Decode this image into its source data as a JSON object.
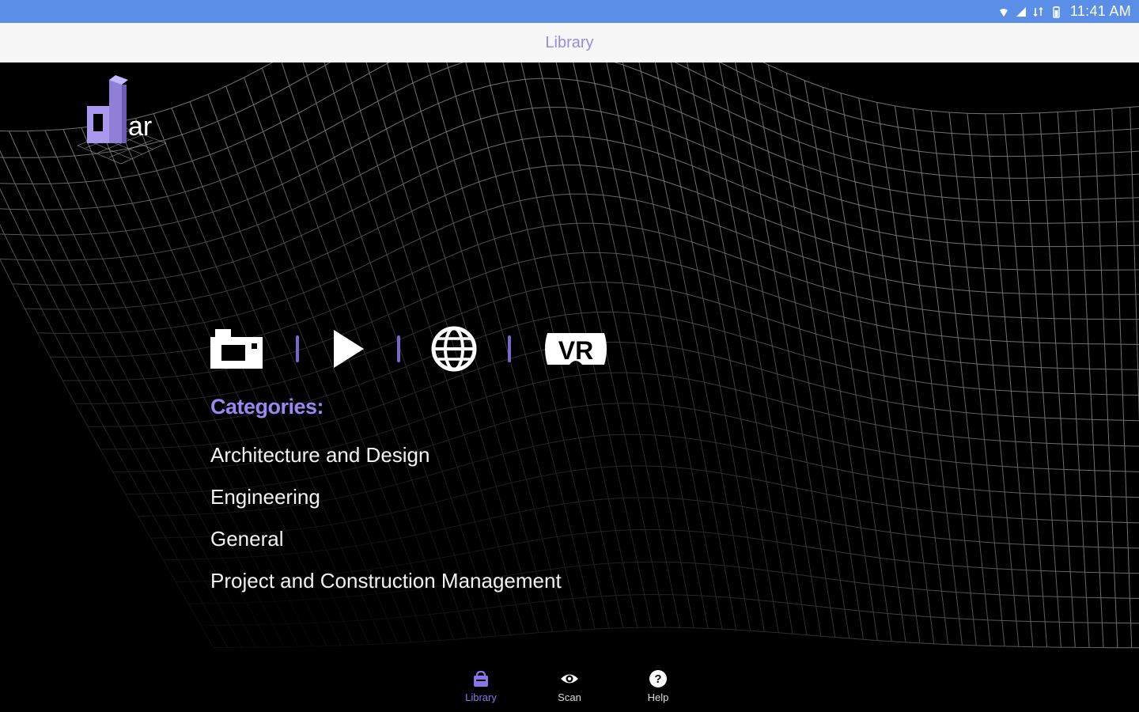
{
  "status_bar": {
    "time": "11:41 AM",
    "icons": [
      "wifi-icon",
      "signal-icon",
      "data-icon",
      "battery-icon"
    ]
  },
  "app_bar": {
    "title": "Library"
  },
  "logo": {
    "text": "dar",
    "icon": "dar-logo"
  },
  "media_icons": [
    "camera-icon",
    "play-icon",
    "globe-icon",
    "vr-icon"
  ],
  "vr_label": "VR",
  "categories": {
    "heading": "Categories:",
    "items": [
      "Architecture and Design",
      "Engineering",
      "General",
      "Project and Construction Management"
    ]
  },
  "bottom_nav": [
    {
      "label": "Library",
      "icon": "library-icon",
      "active": true
    },
    {
      "label": "Scan",
      "icon": "eye-icon",
      "active": false
    },
    {
      "label": "Help",
      "icon": "help-icon",
      "active": false
    }
  ],
  "colors": {
    "status_bar": "#5b8ee6",
    "app_bar": "#f7f7f7",
    "accent": "#9d86f2",
    "background": "#000000"
  }
}
